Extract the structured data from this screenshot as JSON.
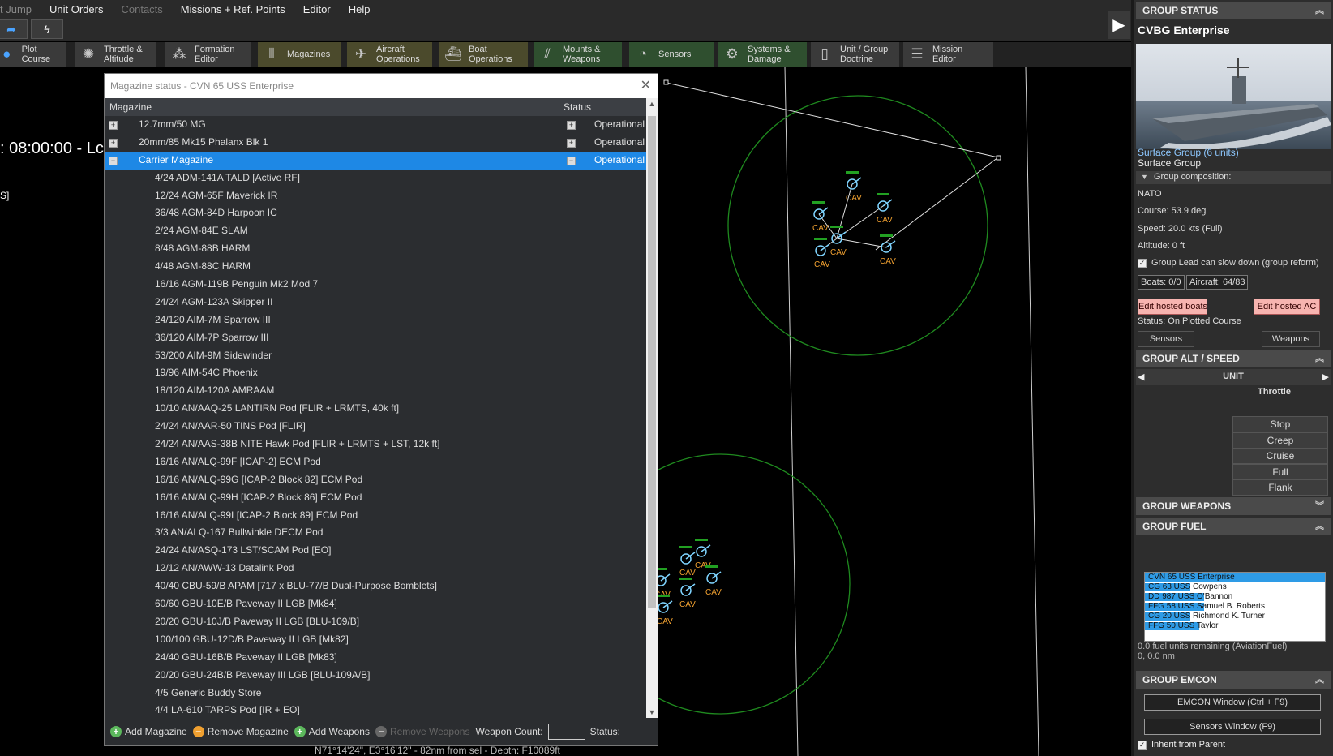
{
  "menu": {
    "items": [
      "t Jump",
      "Unit Orders",
      "Contacts",
      "Missions + Ref. Points",
      "Editor",
      "Help"
    ]
  },
  "toolbar": {
    "buttons": [
      {
        "label1": "Plot Course",
        "label2": ""
      },
      {
        "label1": "Throttle &",
        "label2": "Altitude"
      },
      {
        "label1": "Formation",
        "label2": "Editor"
      },
      {
        "label1": "Magazines",
        "label2": ""
      },
      {
        "label1": "Aircraft",
        "label2": "Operations"
      },
      {
        "label1": "Boat",
        "label2": "Operations"
      },
      {
        "label1": "Mounts &",
        "label2": "Weapons"
      },
      {
        "label1": "Sensors",
        "label2": ""
      },
      {
        "label1": "Systems &",
        "label2": "Damage"
      },
      {
        "label1": "Unit / Group",
        "label2": "Doctrine"
      },
      {
        "label1": "Mission",
        "label2": "Editor"
      }
    ]
  },
  "map": {
    "sim_time": ": 08:00:00 - Lc",
    "side_bracket": "S]",
    "coord_line": "N71°14'24\", E3°16'12\" - 82nm from sel - Depth: F10089ft",
    "unit_label": "CAV"
  },
  "dialog": {
    "title": "Magazine status - CVN 65 USS Enterprise",
    "col_magazine": "Magazine",
    "col_status": "Status",
    "groups": [
      {
        "name": "12.7mm/50 MG",
        "status": "Operational",
        "expanded": false
      },
      {
        "name": "20mm/85 Mk15 Phalanx Blk 1",
        "status": "Operational",
        "expanded": false
      },
      {
        "name": "Carrier Magazine",
        "status": "Operational",
        "expanded": true
      }
    ],
    "weapons": [
      "4/24 ADM-141A TALD [Active RF]",
      "12/24 AGM-65F Maverick IR",
      "36/48 AGM-84D Harpoon IC",
      "2/24 AGM-84E SLAM",
      "8/48 AGM-88B HARM",
      "4/48 AGM-88C HARM",
      "16/16 AGM-119B Penguin Mk2 Mod 7",
      "24/24 AGM-123A Skipper II",
      "24/120 AIM-7M Sparrow III",
      "36/120 AIM-7P Sparrow III",
      "53/200 AIM-9M Sidewinder",
      "19/96 AIM-54C Phoenix",
      "18/120 AIM-120A AMRAAM",
      "10/10 AN/AAQ-25 LANTIRN Pod [FLIR + LRMTS, 40k ft]",
      "24/24 AN/AAR-50 TINS Pod [FLIR]",
      "24/24 AN/AAS-38B NITE Hawk Pod [FLIR + LRMTS + LST, 12k ft]",
      "16/16 AN/ALQ-99F [ICAP-2] ECM Pod",
      "16/16 AN/ALQ-99G [ICAP-2 Block 82] ECM Pod",
      "16/16 AN/ALQ-99H [ICAP-2 Block 86] ECM Pod",
      "16/16 AN/ALQ-99I [ICAP-2 Block 89] ECM Pod",
      "3/3 AN/ALQ-167 Bullwinkle DECM Pod",
      "24/24 AN/ASQ-173 LST/SCAM Pod [EO]",
      "12/12 AN/AWW-13 Datalink Pod",
      "40/40 CBU-59/B APAM [717 x BLU-77/B Dual-Purpose Bomblets]",
      "60/60 GBU-10E/B Paveway II LGB [Mk84]",
      "20/20 GBU-10J/B Paveway II LGB [BLU-109/B]",
      "100/100 GBU-12D/B Paveway II LGB [Mk82]",
      "24/40 GBU-16B/B Paveway II LGB [Mk83]",
      "20/20 GBU-24B/B Paveway III LGB [BLU-109A/B]",
      "4/5 Generic Buddy Store",
      "4/4 LA-610 TARPS Pod [IR + EO]"
    ],
    "footer": {
      "add_magazine": "Add Magazine",
      "remove_magazine": "Remove Magazine",
      "add_weapons": "Add Weapons",
      "remove_weapons": "Remove Weapons",
      "weapon_count": "Weapon Count:",
      "status": "Status:"
    }
  },
  "panel": {
    "group_status": "GROUP STATUS",
    "group_name": "CVBG Enterprise",
    "group_link": "Surface Group (6 units)",
    "group_type": "Surface Group",
    "group_composition": "Group composition:",
    "side": "NATO",
    "course": "Course: 53.9 deg",
    "speed": "Speed: 20.0 kts (Full)",
    "altitude": "Altitude: 0 ft",
    "group_lead": "Group Lead can slow down (group reform)",
    "boats": "Boats: 0/0",
    "aircraft": "Aircraft: 64/83",
    "edit_boats": "Edit hosted boats",
    "edit_ac": "Edit hosted AC",
    "status": "Status: On Plotted Course",
    "sensors_btn": "Sensors",
    "weapons_btn": "Weapons",
    "alt_speed": "GROUP ALT / SPEED",
    "unit": "UNIT",
    "throttle": "Throttle",
    "speeds": [
      "Stop",
      "Creep",
      "Cruise",
      "Full",
      "Flank"
    ],
    "group_weapons": "GROUP WEAPONS",
    "group_fuel": "GROUP FUEL",
    "fuel_units": [
      {
        "name": "CVN 65 USS Enterprise",
        "level": 1.0
      },
      {
        "name": "CG 63 USS Cowpens",
        "level": 0.25
      },
      {
        "name": "DD 987 USS O'Bannon",
        "level": 0.33
      },
      {
        "name": "FFG 58 USS Samuel B. Roberts",
        "level": 0.33
      },
      {
        "name": "CG 20 USS Richmond K. Turner",
        "level": 0.25
      },
      {
        "name": "FFG 50 USS Taylor",
        "level": 0.3
      }
    ],
    "fuel_remaining": "0.0 fuel units remaining (AviationFuel)",
    "fuel_range": "0, 0.0 nm",
    "group_emcon": "GROUP EMCON",
    "emcon_window": "EMCON Window (Ctrl + F9)",
    "sensors_window": "Sensors Window (F9)",
    "inherit": "Inherit from Parent"
  },
  "colors": {
    "accent_blue": "#1e88e5",
    "map_green": "#1f8a1f",
    "unit_cyan": "#7fd4ff",
    "unit_label": "#f0a030"
  }
}
